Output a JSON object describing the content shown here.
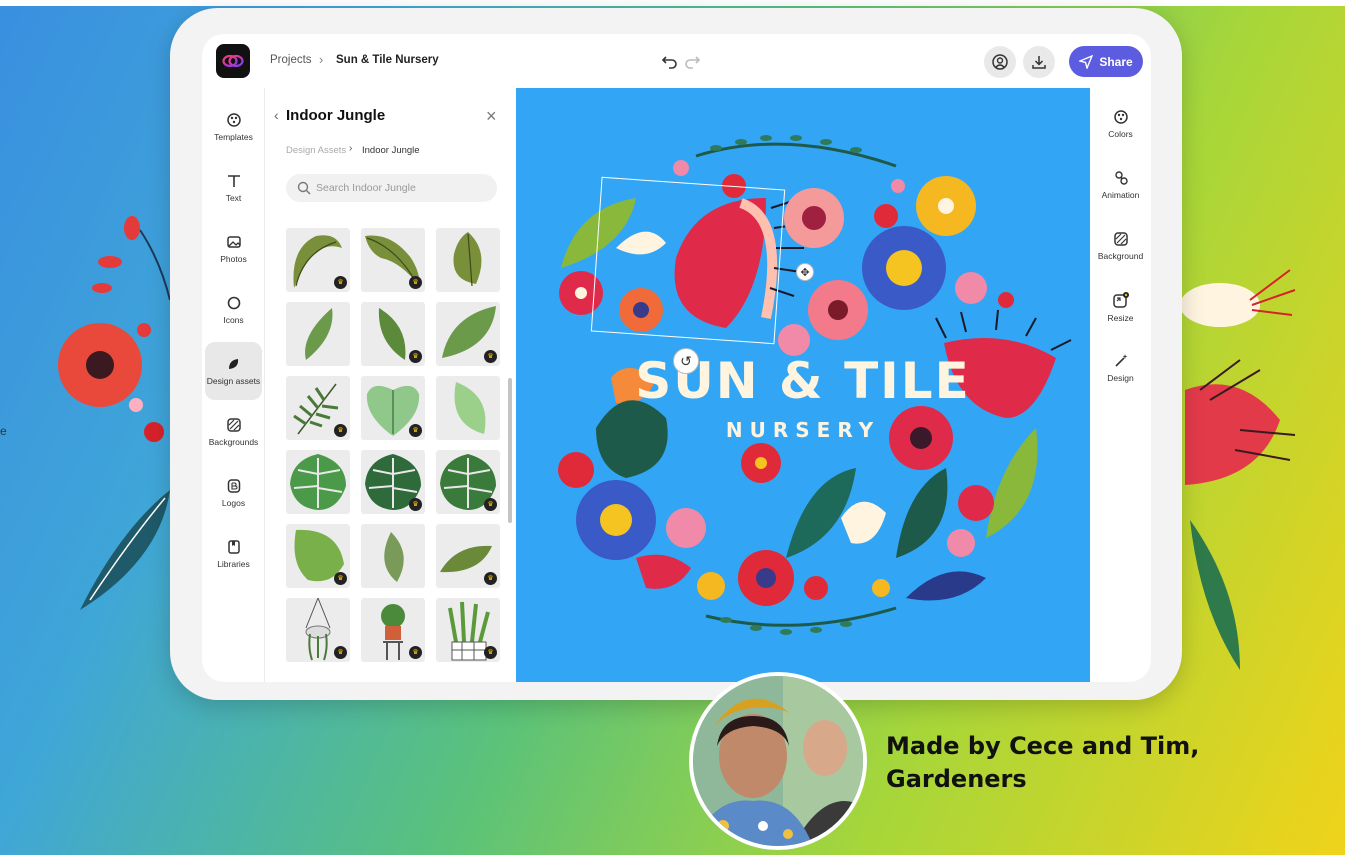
{
  "header": {
    "breadcrumb_projects": "Projects",
    "breadcrumb_file": "Sun & Tile Nursery",
    "share_label": "Share",
    "accent_color": "#5c5ce0"
  },
  "left_rail": {
    "items": [
      {
        "label": "Templates",
        "icon": "templates-icon"
      },
      {
        "label": "Text",
        "icon": "text-icon"
      },
      {
        "label": "Photos",
        "icon": "photos-icon"
      },
      {
        "label": "Icons",
        "icon": "icons-icon"
      },
      {
        "label": "Design assets",
        "icon": "design-assets-icon",
        "active": true
      },
      {
        "label": "Backgrounds",
        "icon": "backgrounds-icon"
      },
      {
        "label": "Logos",
        "icon": "logos-icon"
      },
      {
        "label": "Libraries",
        "icon": "libraries-icon"
      }
    ]
  },
  "panel": {
    "title": "Indoor Jungle",
    "breadcrumb_parent": "Design Assets",
    "breadcrumb_current": "Indoor Jungle",
    "search_placeholder": "Search Indoor Jungle"
  },
  "canvas": {
    "title": "SUN & TILE",
    "subtitle": "NURSERY",
    "background_color": "#32a6f4"
  },
  "right_rail": {
    "items": [
      {
        "label": "Colors",
        "icon": "colors-icon"
      },
      {
        "label": "Animation",
        "icon": "animation-icon"
      },
      {
        "label": "Background",
        "icon": "background-icon"
      },
      {
        "label": "Resize",
        "icon": "resize-icon"
      },
      {
        "label": "Design",
        "icon": "design-icon"
      }
    ]
  },
  "caption": {
    "line1": "Made by Cece and Tim,",
    "line2": "Gardeners"
  },
  "edge_text": "e"
}
